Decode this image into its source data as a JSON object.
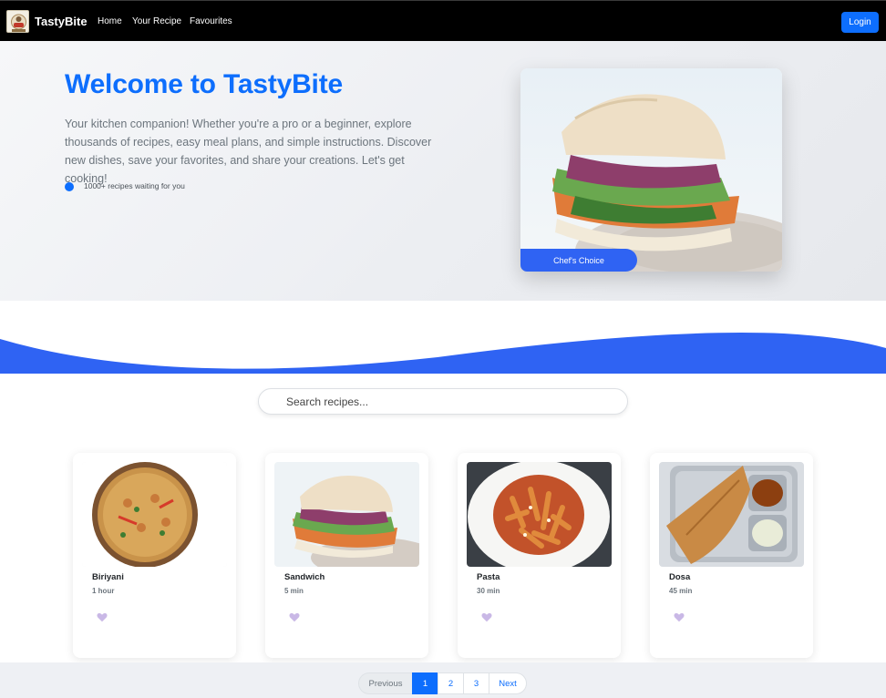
{
  "nav": {
    "brand": "TastyBite",
    "links": [
      "Home",
      "Your Recipe",
      "Favourites"
    ],
    "login_label": "Login"
  },
  "hero": {
    "title": "Welcome to TastyBite",
    "description": "Your kitchen companion! Whether you're a pro or a beginner, explore thousands of recipes, easy meal plans, and simple instructions. Discover new dishes, save your favorites, and share your creations. Let's get cooking!",
    "stat_text": "1000+ recipes waiting for you",
    "badge_label": "Chef's Choice"
  },
  "search": {
    "placeholder": "Search recipes..."
  },
  "recipes": [
    {
      "name": "Biriyani",
      "time": "1 hour"
    },
    {
      "name": "Sandwich",
      "time": "5 min"
    },
    {
      "name": "Pasta",
      "time": "30 min"
    },
    {
      "name": "Dosa",
      "time": "45 min"
    }
  ],
  "pagination": {
    "prev_label": "Previous",
    "pages": [
      "1",
      "2",
      "3"
    ],
    "next_label": "Next"
  },
  "colors": {
    "primary": "#0d6efd",
    "wave": "#2f63f3",
    "navbar": "#000000",
    "heart": "#c9b8e6"
  },
  "icons": {
    "logo": "tastybite-logo-icon",
    "status": "dot-icon",
    "favourite": "heart-icon"
  }
}
